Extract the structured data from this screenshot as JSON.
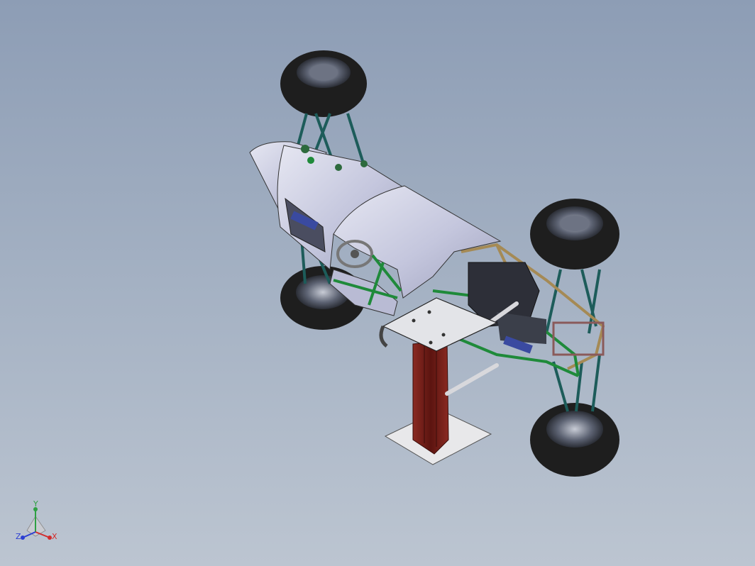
{
  "viewport": {
    "background_top": "#8d9db5",
    "background_bottom": "#bcc5d1"
  },
  "model": {
    "body_color": "#c7c9e0",
    "frame_green": "#1f8a3a",
    "frame_teal": "#1d5c5a",
    "frame_tan": "#a58a55",
    "stand_red": "#6e1a16",
    "tire_color": "#1e1e1e"
  },
  "triad": {
    "y_label": "Y",
    "x_label": "X",
    "z_label": "Z",
    "y_color": "#2ea043",
    "x_color": "#d22c2c",
    "z_color": "#2c3fd2"
  }
}
